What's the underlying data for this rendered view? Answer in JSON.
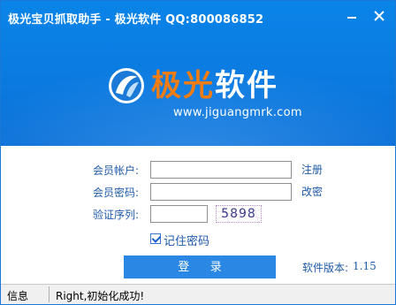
{
  "window": {
    "title": "极光宝贝抓取助手 - 极光软件 QQ:800086852",
    "brand_color": "#0a7ee4"
  },
  "banner": {
    "logo_text_accent": "极光",
    "logo_text_main": "软件",
    "url": "www.jiguangmrk.com",
    "logo_icon": "aurora-logo-icon"
  },
  "form": {
    "member_account_label": "会员帐户:",
    "member_account_value": "",
    "member_password_label": "会员密码:",
    "member_password_value": "",
    "verify_serial_label": "验证序列:",
    "verify_serial_value": "",
    "captcha_code": "5898",
    "register_link": "注册",
    "change_password_link": "改密",
    "remember_password_label": "记住密码",
    "remember_password_checked": true,
    "login_button": "登 录",
    "version_label": "软件版本:",
    "version_value": "1.15"
  },
  "statusbar": {
    "label": "信息",
    "message": "Right,初始化成功!"
  }
}
